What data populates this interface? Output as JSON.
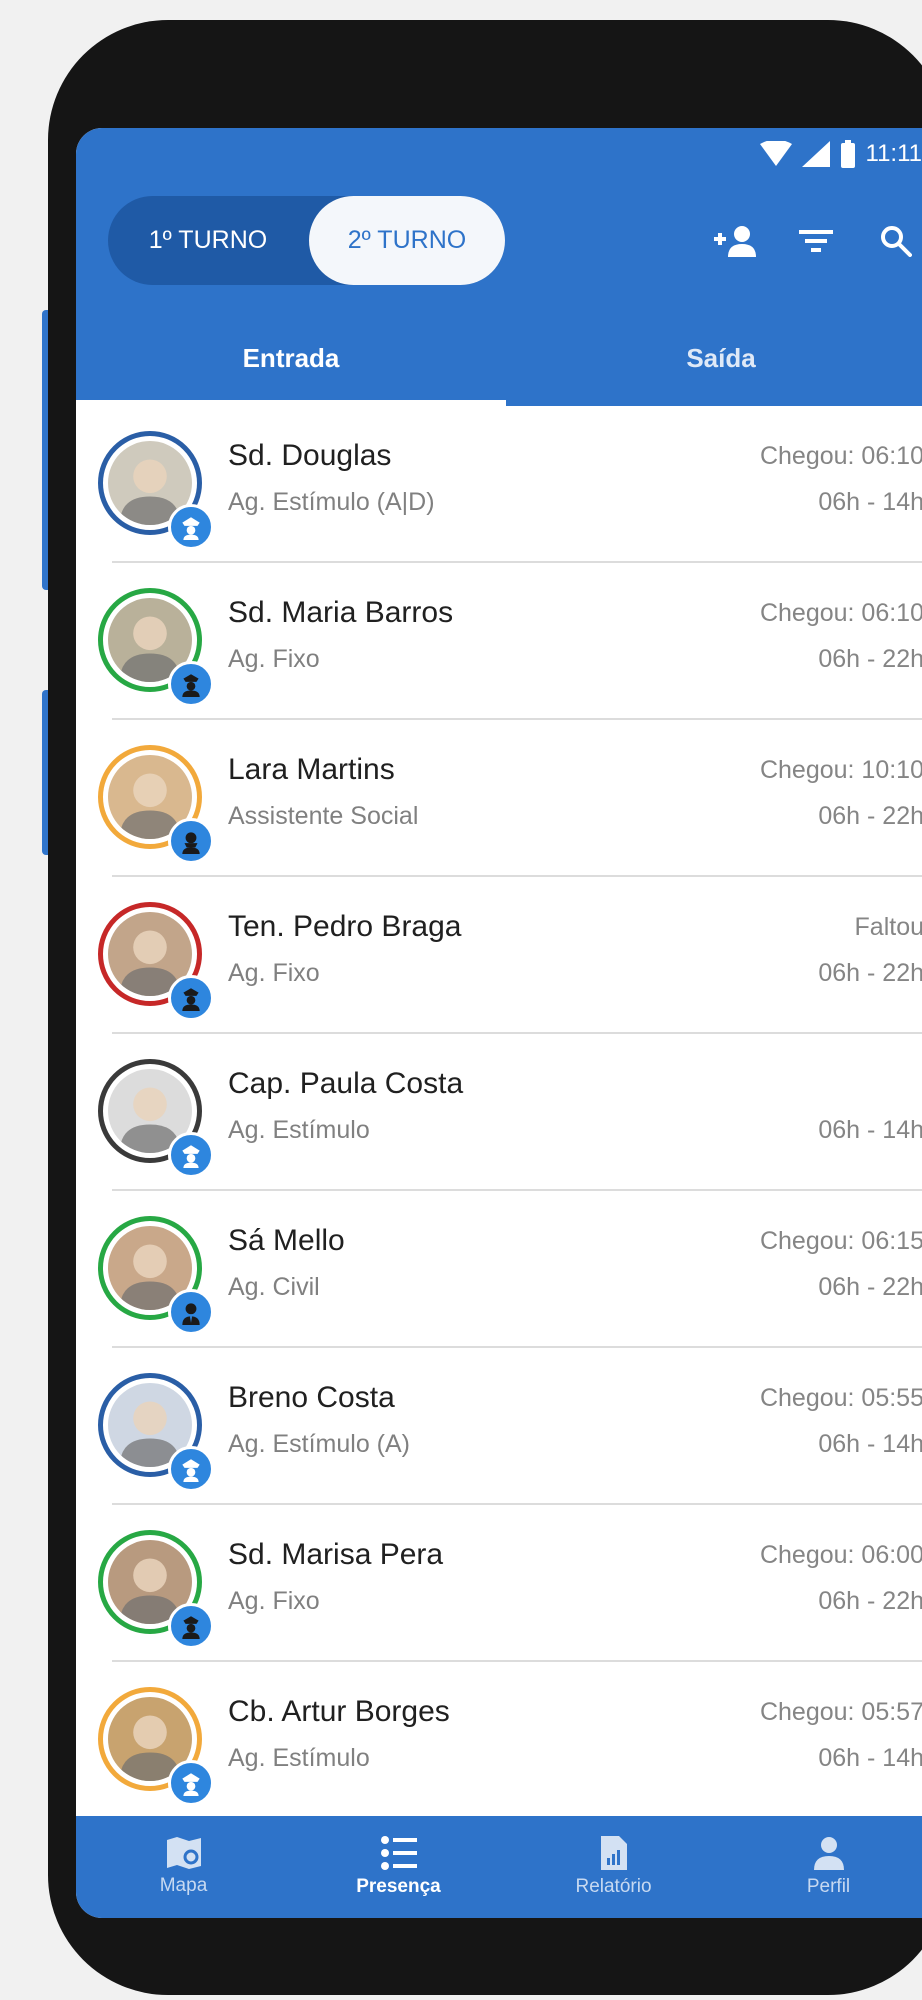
{
  "status_bar": {
    "time": "11:11"
  },
  "shift_toggle": {
    "first": "1º TURNO",
    "second": "2º TURNO",
    "selected": "2º TURNO"
  },
  "header_icons": [
    "add-user-icon",
    "filter-icon",
    "search-icon"
  ],
  "tabs": [
    {
      "label": "Entrada",
      "active": true
    },
    {
      "label": "Saída",
      "active": false
    }
  ],
  "attendance": [
    {
      "name": "Sd. Douglas",
      "role": "Ag. Estímulo (A|D)",
      "arrival": "Chegou: 06:10",
      "hours": "06h - 14h",
      "ring": "#2a5ea6",
      "badge": "police-cap-icon"
    },
    {
      "name": "Sd. Maria Barros",
      "role": "Ag. Fixo",
      "arrival": "Chegou: 06:10",
      "hours": "06h - 22h",
      "ring": "#27a844",
      "badge": "police-officer-icon"
    },
    {
      "name": "Lara Martins",
      "role": "Assistente Social",
      "arrival": "Chegou: 10:10",
      "hours": "06h - 22h",
      "ring": "#f2a93b",
      "badge": "social-worker-icon"
    },
    {
      "name": "Ten. Pedro Braga",
      "role": "Ag. Fixo",
      "arrival": "Faltou",
      "hours": "06h - 22h",
      "ring": "#c62828",
      "badge": "police-officer-icon"
    },
    {
      "name": "Cap. Paula Costa",
      "role": "Ag. Estímulo",
      "arrival": "",
      "hours": "06h - 14h",
      "ring": "#3a3a3a",
      "badge": "police-cap-icon"
    },
    {
      "name": "Sá Mello",
      "role": "Ag. Civil",
      "arrival": "Chegou: 06:15",
      "hours": "06h - 22h",
      "ring": "#27a844",
      "badge": "civil-agent-icon"
    },
    {
      "name": "Breno Costa",
      "role": "Ag. Estímulo (A)",
      "arrival": "Chegou: 05:55",
      "hours": "06h - 14h",
      "ring": "#2a5ea6",
      "badge": "police-cap-icon"
    },
    {
      "name": "Sd. Marisa Pera",
      "role": "Ag. Fixo",
      "arrival": "Chegou: 06:00",
      "hours": "06h - 22h",
      "ring": "#27a844",
      "badge": "police-officer-icon"
    },
    {
      "name": "Cb. Artur Borges",
      "role": "Ag. Estímulo",
      "arrival": "Chegou: 05:57",
      "hours": "06h - 14h",
      "ring": "#f2a93b",
      "badge": "police-cap-icon"
    }
  ],
  "bottom_nav": [
    {
      "label": "Mapa",
      "icon": "map-icon",
      "active": false
    },
    {
      "label": "Presença",
      "icon": "list-icon",
      "active": true
    },
    {
      "label": "Relatório",
      "icon": "report-icon",
      "active": false
    },
    {
      "label": "Perfil",
      "icon": "person-icon",
      "active": false
    }
  ],
  "colors": {
    "primary": "#2e73c9",
    "toggle_track": "#1f5aa6",
    "badge": "#2e86de"
  }
}
